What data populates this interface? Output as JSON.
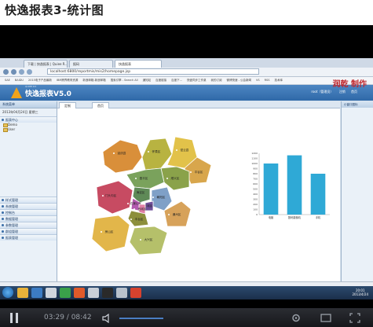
{
  "page": {
    "title": "快逸报表3-统计图"
  },
  "browser": {
    "tabs": [
      {
        "label": "下载 | 快逸报表 | Quiee R..."
      },
      {
        "label": "报码"
      },
      {
        "label": "快逸报表",
        "active": true
      }
    ],
    "url": "localhost:6800/reportmis/mis2/homepage.jsp",
    "bookmarks": [
      "SAE",
      "BAIDU",
      "2015电子产品最新",
      "IBM跨界教育资源",
      "新浪邮箱-新浪邮箱",
      "搜索引擎 - Search All",
      "通知站",
      "百度链接",
      "百度下...",
      "快盘同步工作桌",
      "我的订阅",
      "微博快速 - 公会新闻",
      "VS",
      "RSS",
      "技术库"
    ]
  },
  "app": {
    "subtitle": "QUIEE R3",
    "title": "快逸报表V5.0",
    "user_text": [
      "root（管理员）",
      "注销",
      "首页"
    ],
    "watermark": "润乾 制作"
  },
  "sidebar": {
    "header": "系统菜单",
    "date": "2013年04月24日 星期三",
    "report_center": "报表中心",
    "tree": [
      "Demo",
      "User"
    ],
    "groups": [
      "样式管理",
      "系统管理",
      "控制台",
      "数据管理",
      "参数管理",
      "群组管理",
      "报表管理"
    ]
  },
  "content": {
    "tabs": [
      "定制",
      "首页"
    ]
  },
  "right_panel": {
    "header": "小窗口图标"
  },
  "map": {
    "regions": [
      {
        "name": "延庆县",
        "color": "#d98f3a"
      },
      {
        "name": "怀柔区",
        "color": "#b8b341"
      },
      {
        "name": "密云县",
        "color": "#e2c24a"
      },
      {
        "name": "平谷区",
        "color": "#d8a64c"
      },
      {
        "name": "顺义区",
        "color": "#8aa24a"
      },
      {
        "name": "昌平区",
        "color": "#7aa25c"
      },
      {
        "name": "门头沟区",
        "color": "#c74b62"
      },
      {
        "name": "海淀区",
        "color": "#5f8a57"
      },
      {
        "name": "朝阳区",
        "color": "#7fa0c7"
      },
      {
        "name": "石景山区",
        "color": "#b45bb0"
      },
      {
        "name": "东城区",
        "color": "#6f4f9a"
      },
      {
        "name": "西城区",
        "color": "#e07fa6"
      },
      {
        "name": "丰台区",
        "color": "#8c8f3c"
      },
      {
        "name": "通州区",
        "color": "#d7a25a"
      },
      {
        "name": "房山区",
        "color": "#e2b64a"
      },
      {
        "name": "大兴区",
        "color": "#b5c06a"
      }
    ],
    "selected_label": "房山区"
  },
  "chart_data": {
    "type": "bar",
    "title": "",
    "xlabel": "",
    "ylabel": "",
    "categories": [
      "电脑",
      "数码摄像机",
      "手机"
    ],
    "values": [
      1000,
      1160,
      800
    ],
    "ylim": [
      0,
      1200
    ],
    "yticks": [
      "0",
      "100",
      "200",
      "300",
      "400",
      "500",
      "600",
      "700",
      "800",
      "900",
      "1000",
      "1100",
      "1200"
    ],
    "color": "#2fa9d6",
    "grid": false
  },
  "taskbar": {
    "time": "20:01",
    "date": "2013/4/24"
  },
  "player": {
    "time": "03:29 / 08:42"
  }
}
